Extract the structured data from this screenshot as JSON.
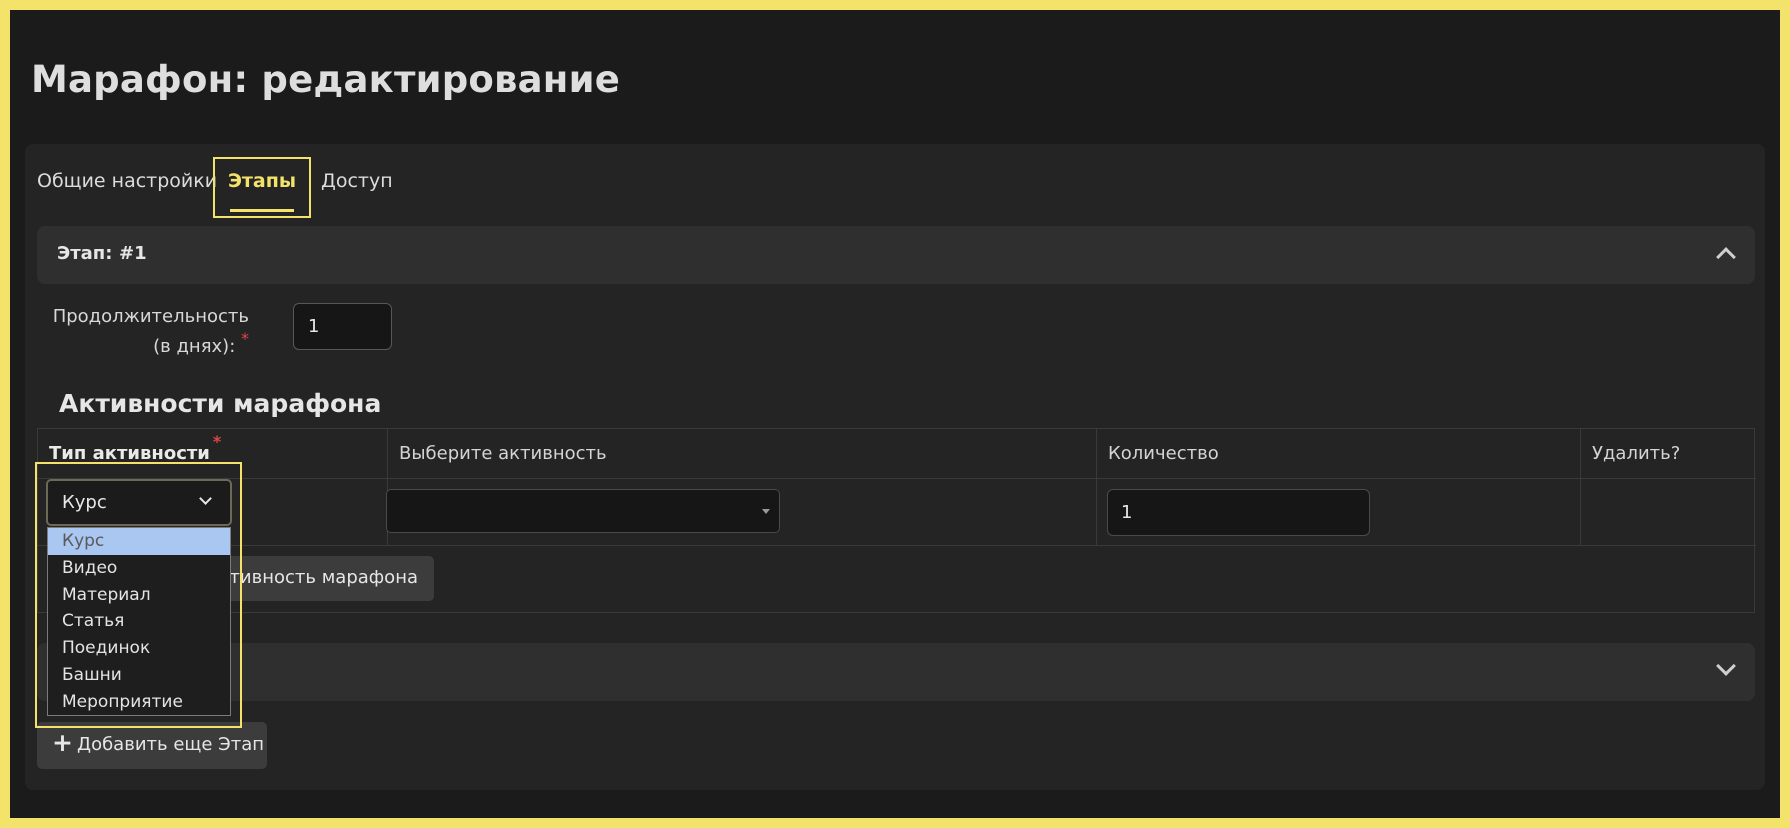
{
  "page": {
    "title": "Марафон: редактирование"
  },
  "tabs": [
    {
      "label": "Общие настройки",
      "active": false
    },
    {
      "label": "Этапы",
      "active": true
    },
    {
      "label": "Доступ",
      "active": false
    }
  ],
  "stage": {
    "label": "Этап:",
    "number": "#1",
    "expanded": true
  },
  "duration": {
    "label": "Продолжительность (в днях):",
    "required_mark": "*",
    "value": "1"
  },
  "activities": {
    "title": "Активности марафона",
    "columns": [
      {
        "label": "Тип активности",
        "required": true
      },
      {
        "label": "Выберите активность"
      },
      {
        "label": "Количество"
      },
      {
        "label": "Удалить?"
      }
    ],
    "row": {
      "type_value": "Курс",
      "activity_value": "",
      "quantity": "1"
    },
    "add_button": "Добавить активность марафона",
    "add_button_visible": "ктивность марафона"
  },
  "type_options": [
    "Курс",
    "Видео",
    "Материал",
    "Статья",
    "Поединок",
    "Башни",
    "Мероприятие"
  ],
  "selected_option_index": 0,
  "add_stage_button": "Добавить еще Этап",
  "highlight_color": "#f3e36a"
}
